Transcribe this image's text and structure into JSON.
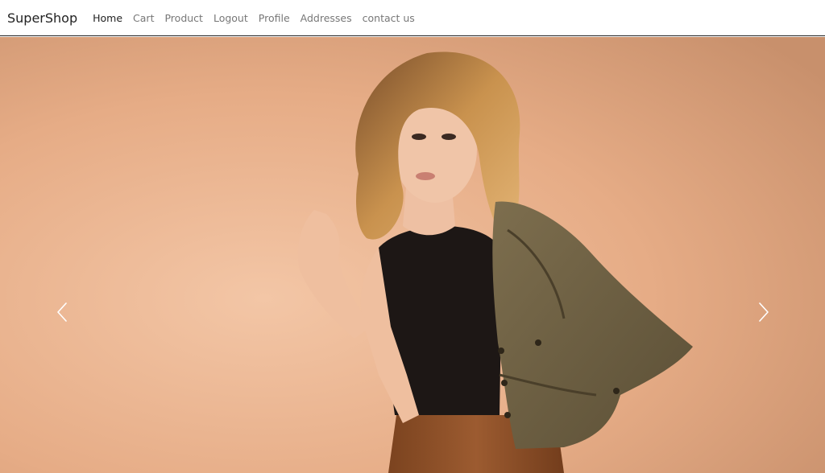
{
  "navbar": {
    "brand": "SuperShop",
    "links": [
      {
        "label": "Home",
        "active": true
      },
      {
        "label": "Cart"
      },
      {
        "label": "Product"
      },
      {
        "label": "Logout"
      },
      {
        "label": "Profile"
      },
      {
        "label": "Addresses"
      },
      {
        "label": "contact us"
      }
    ]
  },
  "carousel": {
    "prev_icon": "chevron-left-icon",
    "next_icon": "chevron-right-icon",
    "slide_image": "fashion-model-photo",
    "colors": {
      "background": "#e8b08a",
      "top": "#c89574",
      "hair": "#b27a3f",
      "top_garment": "#1c1614",
      "jacket": "#6f6245",
      "skirt": "#8a4f2a",
      "skin": "#f0c2a5"
    }
  }
}
